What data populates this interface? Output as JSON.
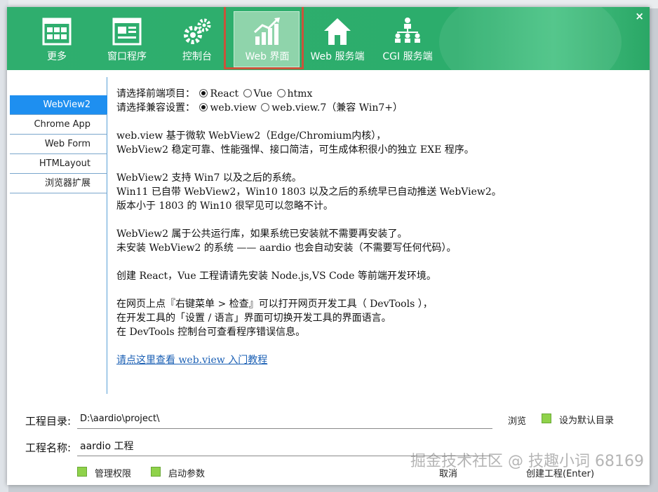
{
  "window": {
    "close_label": "×"
  },
  "tabs": [
    {
      "label": "更多",
      "icon": "window-grid-icon"
    },
    {
      "label": "窗口程序",
      "icon": "form-window-icon"
    },
    {
      "label": "控制台",
      "icon": "gears-icon"
    },
    {
      "label": "Web 界面",
      "icon": "chart-up-icon"
    },
    {
      "label": "Web 服务端",
      "icon": "house-icon"
    },
    {
      "label": "CGI 服务端",
      "icon": "org-chart-icon"
    }
  ],
  "nav": [
    {
      "label": "WebView2"
    },
    {
      "label": "Chrome App"
    },
    {
      "label": "Web Form"
    },
    {
      "label": "HTMLayout"
    },
    {
      "label": "浏览器扩展"
    }
  ],
  "options": {
    "frontend_label": "请选择前端项目：",
    "frontend_choices": [
      "React",
      "Vue",
      "htmx"
    ],
    "frontend_selected": "React",
    "compat_label": "请选择兼容设置：",
    "compat_choices": [
      "web.view",
      "web.view.7（兼容 Win7+）"
    ],
    "compat_selected": "web.view"
  },
  "paragraphs": {
    "p1": [
      "web.view 基于微软 WebView2（Edge/Chromium内核），",
      "WebView2 稳定可靠、性能强悍、接口简洁，可生成体积很小的独立 EXE 程序。"
    ],
    "p2": [
      "WebView2 支持 Win7 以及之后的系统。",
      "Win11 已自带 WebView2，Win10 1803 以及之后的系统早已自动推送 WebView2。",
      "版本小于 1803 的 Win10 很罕见可以忽略不计。"
    ],
    "p3": [
      "WebView2 属于公共运行库，如果系统已安装就不需要再安装了。",
      "未安装 WebView2 的系统 —— aardio 也会自动安装（不需要写任何代码）。"
    ],
    "p4": [
      "创建 React，Vue 工程请请先安装 Node.js,VS Code 等前端开发环境。"
    ],
    "p5": [
      "在网页上点『右键菜单 > 检查』可以打开网页开发工具（ DevTools ），",
      "在开发工具的「设置 / 语言」界面可切换开发工具的界面语言。",
      "在 DevTools 控制台可查看程序错误信息。"
    ],
    "link": "请点这里查看 web.view 入门教程"
  },
  "project": {
    "dir_label": "工程目录:",
    "dir_value": "D:\\aardio\\project\\",
    "browse_label": "浏览",
    "default_dir_label": "设为默认目录",
    "name_label": "工程名称:",
    "name_value": "aardio 工程",
    "admin_label": "管理权限",
    "startup_label": "启动参数",
    "cancel_label": "取消",
    "create_label": "创建工程(Enter)"
  },
  "watermark": "掘金技术社区 @ 技趣小词 68169",
  "colors": {
    "header_green": "#2fae6e",
    "nav_selected": "#1e8ff0",
    "checkbox_green": "#8fd24a",
    "active_tab_border": "#c9543a"
  }
}
